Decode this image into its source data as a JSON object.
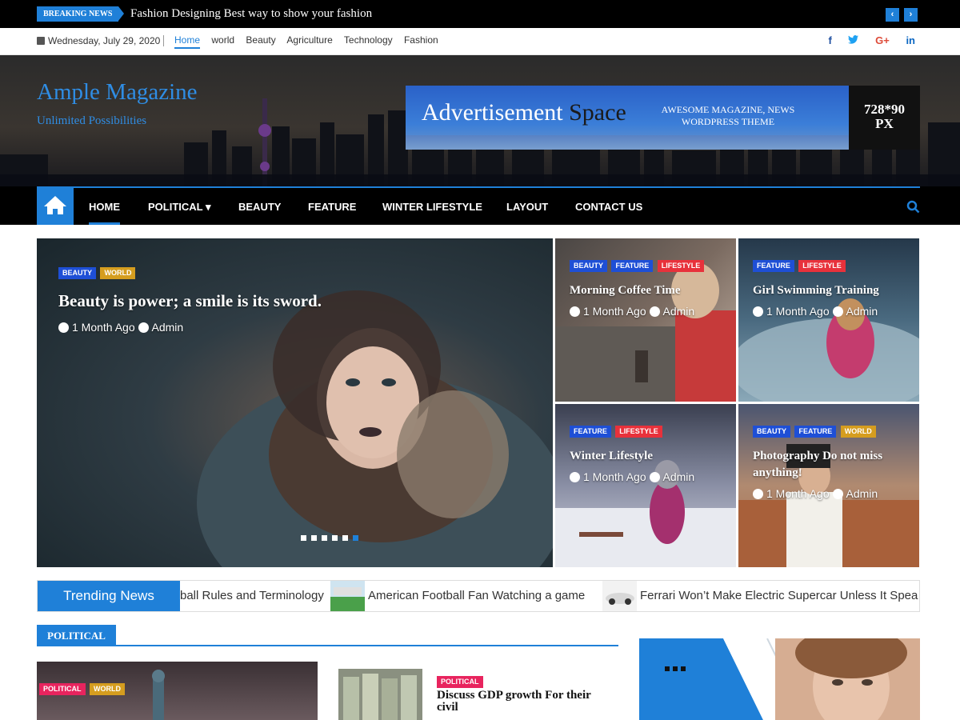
{
  "breaking": {
    "label": "BREAKING NEWS",
    "headline": "Fashion Designing Best way to show your fashion",
    "prev": "‹",
    "next": "›"
  },
  "topbar": {
    "date": "Wednesday, July 29, 2020",
    "links": [
      "Home",
      "world",
      "Beauty",
      "Agriculture",
      "Technology",
      "Fashion"
    ],
    "social": [
      {
        "icon": "facebook-icon",
        "glyph": "f",
        "color": "#1f4fa0"
      },
      {
        "icon": "twitter-icon",
        "glyph": "t",
        "color": "#1da1f2"
      },
      {
        "icon": "google-plus-icon",
        "glyph": "G+",
        "color": "#dd4b39"
      },
      {
        "icon": "linkedin-icon",
        "glyph": "in",
        "color": "#0a66c2"
      }
    ]
  },
  "header": {
    "site_title": "Ample Magazine",
    "tagline": "Unlimited Possibilities",
    "ad": {
      "title_main": "Advertisement ",
      "title_dark": "Space",
      "sub_line1": "AWESOME MAGAZINE, NEWS",
      "sub_line2": "WORDPRESS THEME",
      "size_line1": "728*90",
      "size_line2": "PX"
    }
  },
  "nav": {
    "items": [
      "HOME",
      "POLITICAL",
      "BEAUTY",
      "FEATURE",
      "WINTER LIFESTYLE",
      "LAYOUT",
      "CONTACT US"
    ],
    "dropdown_glyph": "▾"
  },
  "hero": {
    "main": {
      "tags": [
        "BEAUTY",
        "WORLD"
      ],
      "title": "Beauty is power; a smile is its sword.",
      "time": "1 Month Ago",
      "author": "Admin"
    },
    "cards": [
      {
        "tags": [
          "BEAUTY",
          "FEATURE",
          "LIFESTYLE"
        ],
        "title": "Morning Coffee Time",
        "time": "1 Month Ago",
        "author": "Admin"
      },
      {
        "tags": [
          "FEATURE",
          "LIFESTYLE"
        ],
        "title": "Girl Swimming Training",
        "time": "1 Month Ago",
        "author": "Admin"
      },
      {
        "tags": [
          "FEATURE",
          "LIFESTYLE"
        ],
        "title": "Winter Lifestyle",
        "time": "1 Month Ago",
        "author": "Admin"
      },
      {
        "tags": [
          "BEAUTY",
          "FEATURE",
          "WORLD"
        ],
        "title_line1": "Photography Do not miss",
        "title_line2": "anything!",
        "time": "1 Month Ago",
        "author": "Admin"
      }
    ]
  },
  "trending": {
    "label": "Trending News",
    "items": [
      "ball Rules and Terminology",
      "American Football Fan Watching a game",
      "Ferrari Won’t Make Electric Supercar Unless It Spea"
    ]
  },
  "political": {
    "heading": "POLITICAL",
    "big_tags": [
      "POLITICAL",
      "WORLD"
    ],
    "small_tag": "POLITICAL",
    "small_title_line1": "Discuss GDP growth For their",
    "small_title_line2": "civil"
  },
  "colors": {
    "accent": "#1f80d8",
    "tag_blue": "#1e4fd6",
    "tag_red": "#e8313b",
    "tag_gold": "#d59d1f",
    "tag_pink": "#e8245e"
  }
}
